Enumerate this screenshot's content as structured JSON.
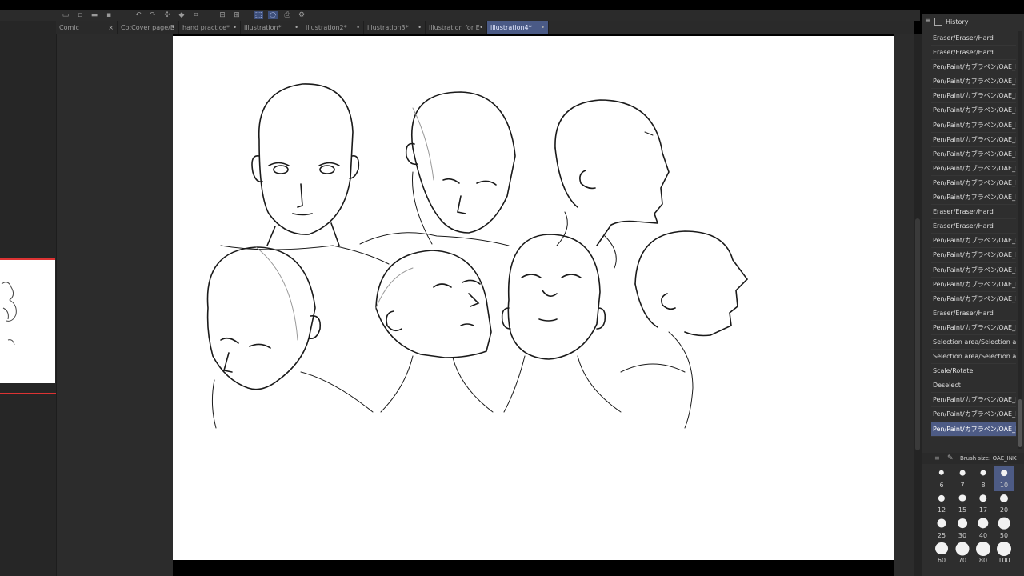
{
  "toolbar": {
    "icons": [
      "window-icon",
      "new-icon",
      "open-icon",
      "save-icon",
      "undo-icon",
      "redo-icon",
      "transform-icon",
      "fill-icon",
      "crop-icon",
      "ruler-icon",
      "select-icon",
      "lasso-icon",
      "grid-icon",
      "print-icon",
      "settings-icon"
    ]
  },
  "tabs": [
    {
      "label": "Comic",
      "close": "×"
    },
    {
      "label": "Co:Cover page/B",
      "close": "•"
    },
    {
      "label": "hand practice*",
      "close": "•"
    },
    {
      "label": "illustration*",
      "close": "•"
    },
    {
      "label": "illustration2*",
      "close": "•"
    },
    {
      "label": "illustration3*",
      "close": "•"
    },
    {
      "label": "illustration for E",
      "close": "•"
    },
    {
      "label": "illustration4*",
      "close": "•",
      "active": true
    }
  ],
  "history": {
    "title": "History",
    "items": [
      "Eraser/Eraser/Hard",
      "Eraser/Eraser/Hard",
      "Pen/Paint/カブラペン/OAE_IN",
      "Pen/Paint/カブラペン/OAE_IN",
      "Pen/Paint/カブラペン/OAE_IN",
      "Pen/Paint/カブラペン/OAE_IN",
      "Pen/Paint/カブラペン/OAE_IN",
      "Pen/Paint/カブラペン/OAE_IN",
      "Pen/Paint/カブラペン/OAE_IN",
      "Pen/Paint/カブラペン/OAE_IN",
      "Pen/Paint/カブラペン/OAE_IN",
      "Pen/Paint/カブラペン/OAE_IN",
      "Eraser/Eraser/Hard",
      "Eraser/Eraser/Hard",
      "Pen/Paint/カブラペン/OAE_IN",
      "Pen/Paint/カブラペン/OAE_IN",
      "Pen/Paint/カブラペン/OAE_IN",
      "Pen/Paint/カブラペン/OAE_IN",
      "Pen/Paint/カブラペン/OAE_IN",
      "Eraser/Eraser/Hard",
      "Pen/Paint/カブラペン/OAE_IN",
      "Selection area/Selection area/Lasso",
      "Selection area/Selection area/Lasso",
      "Scale/Rotate",
      "Deselect",
      "Pen/Paint/カブラペン/OAE_IN",
      "Pen/Paint/カブラペン/OAE_IN",
      "Pen/Paint/カブラペン/OAE_IN"
    ],
    "selected_index": 27
  },
  "brush_size": {
    "title": "Brush size: OAE_INK",
    "sizes": [
      "6",
      "7",
      "8",
      "10",
      "12",
      "15",
      "17",
      "20",
      "25",
      "30",
      "40",
      "50",
      "60",
      "70",
      "80",
      "100"
    ],
    "selected": "10"
  }
}
